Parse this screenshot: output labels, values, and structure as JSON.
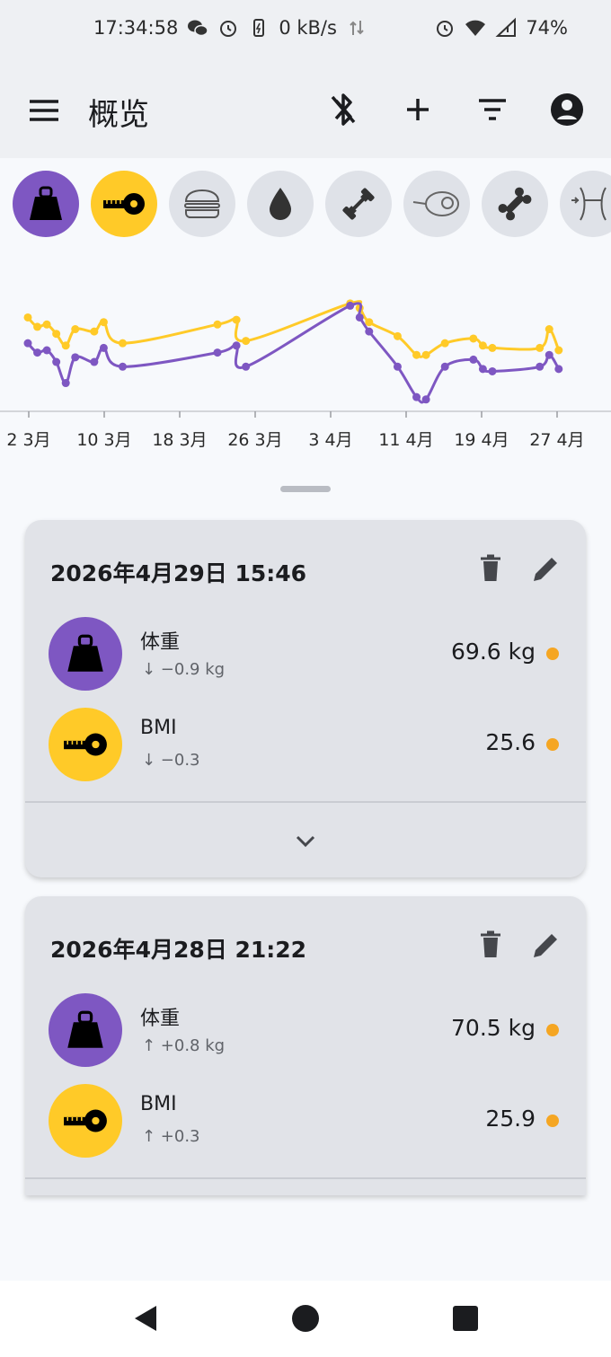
{
  "status": {
    "time": "17:34:58",
    "speed": "0 kB/s",
    "battery": "74%"
  },
  "appbar": {
    "title": "概览",
    "icons": [
      "menu-icon",
      "bluetooth-disabled-icon",
      "add-icon",
      "filter-icon",
      "account-icon"
    ]
  },
  "chips": [
    {
      "name": "weight",
      "icon": "weight-icon",
      "active": true,
      "color": "#7e57c2"
    },
    {
      "name": "bmi",
      "icon": "tape-icon",
      "active": true,
      "color": "#ffca28"
    },
    {
      "name": "fat",
      "icon": "burger-icon",
      "active": false
    },
    {
      "name": "water",
      "icon": "drop-icon",
      "active": false
    },
    {
      "name": "muscle",
      "icon": "dumbbell-icon",
      "active": false
    },
    {
      "name": "lbm",
      "icon": "meat-icon",
      "active": false
    },
    {
      "name": "bone",
      "icon": "bone-icon",
      "active": false
    },
    {
      "name": "waist",
      "icon": "waist-icon",
      "active": false
    }
  ],
  "chart_data": {
    "type": "line",
    "x_tick_labels": [
      "2 3月",
      "10 3月",
      "18 3月",
      "26 3月",
      "3 4月",
      "11 4月",
      "19 4月",
      "27 4月"
    ],
    "series": [
      {
        "color": "#ffca28",
        "points": [
          [
            1,
            71.0
          ],
          [
            2,
            70.6
          ],
          [
            3,
            70.7
          ],
          [
            4,
            70.3
          ],
          [
            5,
            69.8
          ],
          [
            6,
            70.5
          ],
          [
            8,
            70.4
          ],
          [
            9,
            70.8
          ],
          [
            11,
            69.9
          ],
          [
            21,
            70.7
          ],
          [
            23,
            70.9
          ],
          [
            24,
            70.0
          ],
          [
            35,
            71.6
          ],
          [
            36,
            71.4
          ],
          [
            37,
            70.8
          ],
          [
            40,
            70.2
          ],
          [
            42,
            69.4
          ],
          [
            43,
            69.4
          ],
          [
            45,
            69.9
          ],
          [
            48,
            70.1
          ],
          [
            49,
            69.8
          ],
          [
            50,
            69.7
          ],
          [
            55,
            69.7
          ],
          [
            56,
            70.5
          ],
          [
            57,
            69.6
          ]
        ]
      },
      {
        "color": "#7e57c2",
        "points": [
          [
            1,
            69.9
          ],
          [
            2,
            69.5
          ],
          [
            3,
            69.6
          ],
          [
            4,
            69.1
          ],
          [
            5,
            68.2
          ],
          [
            6,
            69.3
          ],
          [
            8,
            69.1
          ],
          [
            9,
            69.7
          ],
          [
            11,
            68.9
          ],
          [
            21,
            69.5
          ],
          [
            23,
            69.8
          ],
          [
            24,
            68.9
          ],
          [
            35,
            71.5
          ],
          [
            36,
            71.0
          ],
          [
            37,
            70.4
          ],
          [
            40,
            68.9
          ],
          [
            42,
            67.6
          ],
          [
            43,
            67.5
          ],
          [
            45,
            68.9
          ],
          [
            48,
            69.2
          ],
          [
            49,
            68.8
          ],
          [
            50,
            68.7
          ],
          [
            55,
            68.9
          ],
          [
            56,
            69.4
          ],
          [
            57,
            68.8
          ]
        ]
      }
    ],
    "x_range": [
      0,
      60
    ],
    "grid": false,
    "legend": "none"
  },
  "cards": [
    {
      "date": "2026年4月29日 15:46",
      "rows": [
        {
          "name": "体重",
          "delta": "↓ −0.9 kg",
          "value": "69.6 kg",
          "icon": "weight-icon"
        },
        {
          "name": "BMI",
          "delta": "↓ −0.3",
          "value": "25.6",
          "icon": "tape-icon"
        }
      ]
    },
    {
      "date": "2026年4月28日 21:22",
      "rows": [
        {
          "name": "体重",
          "delta": "↑ +0.8 kg",
          "value": "70.5 kg",
          "icon": "weight-icon"
        },
        {
          "name": "BMI",
          "delta": "↑ +0.3",
          "value": "25.9",
          "icon": "tape-icon"
        }
      ]
    }
  ]
}
